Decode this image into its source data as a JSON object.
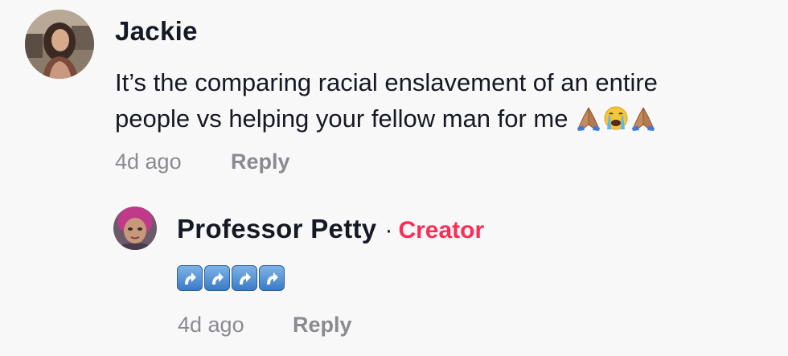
{
  "comment": {
    "username": "Jackie",
    "text_line1": "It’s the comparing racial enslavement of an entire",
    "text_line2": "people vs helping your fellow man for me",
    "emojis": [
      "folded-hands",
      "loudly-crying-face",
      "folded-hands"
    ],
    "time": "4d ago",
    "reply_label": "Reply"
  },
  "reply": {
    "username": "Professor Petty",
    "separator": "·",
    "badge": "Creator",
    "emojis": [
      "arrow-curving-up",
      "arrow-curving-up",
      "arrow-curving-up",
      "arrow-curving-up"
    ],
    "time": "4d ago",
    "reply_label": "Reply"
  },
  "colors": {
    "background": "#f8f8f8",
    "text": "#161823",
    "meta": "#8a8b91",
    "creator": "#fe2c55"
  }
}
